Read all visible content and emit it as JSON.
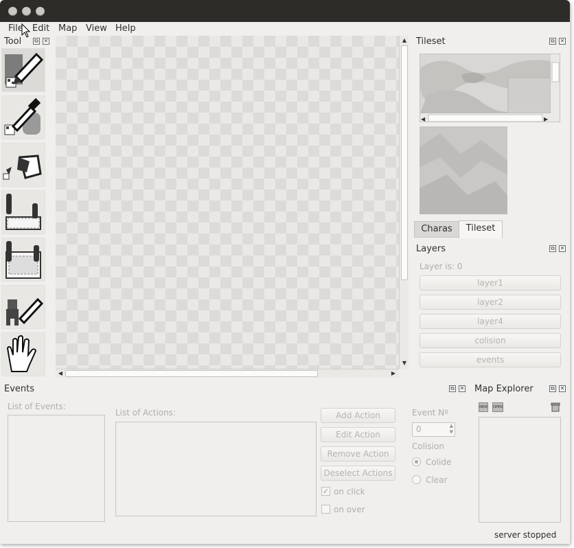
{
  "menu": {
    "file": "File",
    "edit": "Edit",
    "map": "Map",
    "view": "View",
    "help": "Help"
  },
  "tool_dock": {
    "title": "Tool",
    "tools": [
      "pencil-tool",
      "eyedropper-tool",
      "bucket-fill-tool",
      "rectangle-tool",
      "rectangle-fill-tool",
      "character-pencil-tool",
      "hand-tool"
    ]
  },
  "tileset_dock": {
    "title": "Tileset",
    "tabs": [
      "Charas",
      "Tileset"
    ],
    "active_tab": "Tileset"
  },
  "layers_dock": {
    "title": "Layers",
    "status": "Layer is: 0",
    "layers": [
      "layer1",
      "layer2",
      "layer4",
      "colision",
      "events"
    ]
  },
  "events_dock": {
    "title": "Events",
    "list_of_events_label": "List of Events:",
    "list_of_actions_label": "List of Actions:",
    "buttons": [
      "Add Action",
      "Edit Action",
      "Remove Action",
      "Deselect Actions"
    ],
    "on_click_label": "on click",
    "on_click_checked": true,
    "on_over_label": "on over",
    "on_over_checked": false,
    "event_no_label": "Event Nº",
    "event_no_value": "0",
    "colision_label": "Colision",
    "colide_label": "Colide",
    "clear_label": "Clear",
    "colision_selected": "Colide"
  },
  "map_explorer_dock": {
    "title": "Map Explorer",
    "new_icon_text": "NEW",
    "open_icon_text": "OPEN"
  },
  "status_bar": {
    "text": "server stopped"
  },
  "colors": {
    "titlebar": "#2d2c28",
    "window_bg": "#f0efed",
    "disabled_text": "#b0aeaa"
  }
}
